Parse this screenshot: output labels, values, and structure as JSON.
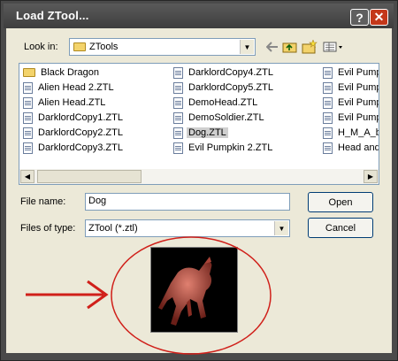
{
  "dialog": {
    "title": "Load ZTool...",
    "help_label": "?",
    "close_label": "✕"
  },
  "lookin": {
    "label": "Look in:",
    "value": "ZTools"
  },
  "files": {
    "col1": [
      "Black Dragon",
      "Alien Head 2.ZTL",
      "Alien Head.ZTL",
      "DarklordCopy1.ZTL",
      "DarklordCopy2.ZTL",
      "DarklordCopy3.ZTL"
    ],
    "col2": [
      "DarklordCopy4.ZTL",
      "DarklordCopy5.ZTL",
      "DemoHead.ZTL",
      "DemoSoldier.ZTL",
      "Dog.ZTL",
      "Evil Pumpkin 2.ZTL"
    ],
    "col3": [
      "Evil Pumpk",
      "Evil Pumpk",
      "Evil Pumpk",
      "Evil Pumpk",
      "H_M_A_ba",
      "Head and "
    ],
    "selected": "Dog.ZTL"
  },
  "filename": {
    "label": "File name:",
    "value": "Dog"
  },
  "filetype": {
    "label": "Files of type:",
    "value": "ZTool (*.ztl)"
  },
  "buttons": {
    "open": "Open",
    "cancel": "Cancel"
  },
  "icons": {
    "up": "up-folder-icon",
    "new_folder": "new-folder-icon",
    "views": "view-menu-icon",
    "back": "back-icon"
  },
  "colors": {
    "annotation": "#d0201a"
  }
}
